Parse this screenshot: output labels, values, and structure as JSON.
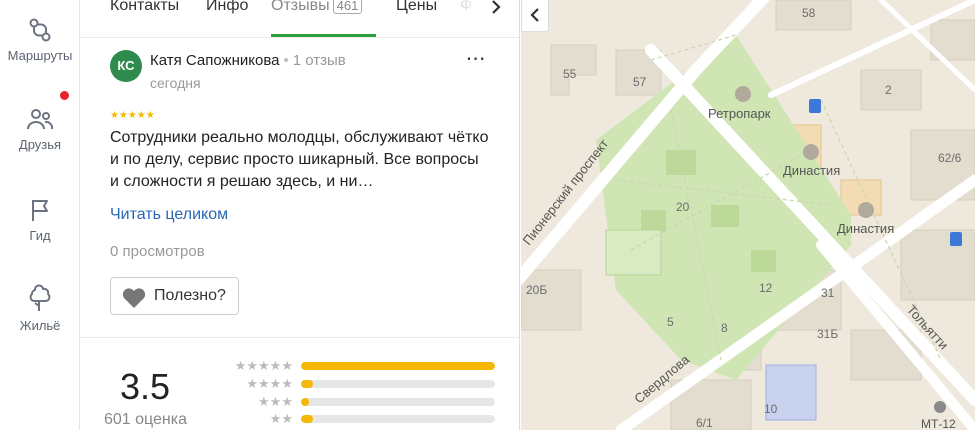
{
  "rail": {
    "items": [
      {
        "label": "Маршруты",
        "icon": "routes-icon"
      },
      {
        "label": "Друзья",
        "icon": "friends-icon"
      },
      {
        "label": "Гид",
        "icon": "guide-flag-icon"
      },
      {
        "label": "Жильё",
        "icon": "housing-icon"
      }
    ],
    "colors": {
      "badge": "#e8232b"
    }
  },
  "tabs": {
    "items": [
      "Контакты",
      "Инфо",
      "Отзывы",
      "Цены"
    ],
    "reviews_count": "461",
    "partial": "Ф",
    "active": "Отзывы"
  },
  "review": {
    "avatar_initials": "КС",
    "author": "Катя Сапожникова",
    "separator": "•",
    "author_reviews": "1 отзыв",
    "date": "сегодня",
    "stars": "★★★★★",
    "text": "Сотрудники реально молодцы, обслуживают чётко и по делу, сервис просто шикарный. Все вопросы и сложности я решаю здесь, и ни…",
    "read_more": "Читать целиком",
    "views": "0 просмотров",
    "useful_label": "Полезно?",
    "more_label": "⋯"
  },
  "rating": {
    "value": "3.5",
    "count": "601 оценка",
    "histogram": [
      {
        "stars": "★★★★★",
        "fraction": 1.0
      },
      {
        "stars": "★★★★",
        "fraction": 0.06
      },
      {
        "stars": "★★★",
        "fraction": 0.04
      },
      {
        "stars": "★★",
        "fraction": 0.06
      }
    ]
  },
  "map": {
    "labels": {
      "pioneer_ave": "Пионерский проспект",
      "sverdlova": "Свердлова",
      "tolyatti": "Тольятти",
      "retropark": "Ретропарк",
      "dinastiya1": "Династия",
      "dinastiya2": "Династия",
      "mt12": "МТ-12",
      "n58": "58",
      "n55": "55",
      "n57": "57",
      "n2": "2",
      "n62_6": "62/6",
      "n20": "20",
      "n20b": "20Б",
      "n12": "12",
      "n31": "31",
      "n5": "5",
      "n8": "8",
      "n31b": "31Б",
      "n10": "10",
      "n6_1": "6/1"
    },
    "colors": {
      "park": "#cfe6b4",
      "road": "#ffffff",
      "ground": "#efe9dd"
    }
  }
}
